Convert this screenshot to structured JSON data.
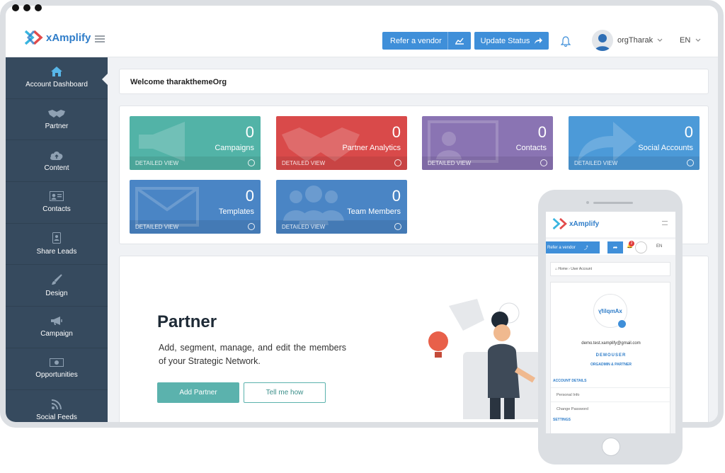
{
  "header": {
    "logo_text": "xAmplify",
    "refer_label": "Refer a vendor",
    "update_label": "Update Status",
    "username": "orgTharak",
    "language": "EN"
  },
  "sidebar": {
    "items": [
      {
        "label": "Account Dashboard",
        "icon": "home-icon"
      },
      {
        "label": "Partner",
        "icon": "handshake-icon"
      },
      {
        "label": "Content",
        "icon": "cloud-upload-icon"
      },
      {
        "label": "Contacts",
        "icon": "contact-card-icon"
      },
      {
        "label": "Share Leads",
        "icon": "share-leads-icon"
      },
      {
        "label": "Design",
        "icon": "brush-icon"
      },
      {
        "label": "Campaign",
        "icon": "megaphone-icon"
      },
      {
        "label": "Opportunities",
        "icon": "money-icon"
      },
      {
        "label": "Social Feeds",
        "icon": "rss-icon"
      }
    ]
  },
  "welcome": "Welcome tharakthemeOrg",
  "stats": [
    {
      "value": "0",
      "title": "Campaigns",
      "footer": "DETAILED VIEW",
      "color": "#52b3a7"
    },
    {
      "value": "0",
      "title": "Partner Analytics",
      "footer": "DETAILED VIEW",
      "color": "#d94a4a"
    },
    {
      "value": "0",
      "title": "Contacts",
      "footer": "DETAILED VIEW",
      "color": "#8a74b3"
    },
    {
      "value": "0",
      "title": "Social Accounts",
      "footer": "DETAILED VIEW",
      "color": "#4c9ad8"
    },
    {
      "value": "0",
      "title": "Templates",
      "footer": "DETAILED VIEW",
      "color": "#4a85c5"
    },
    {
      "value": "0",
      "title": "Team Members",
      "footer": "DETAILED VIEW",
      "color": "#4a85c5"
    }
  ],
  "promo": {
    "title": "Partner",
    "description": "Add, segment, manage, and edit the members of your Strategic Network.",
    "primary_button": "Add Partner",
    "secondary_button": "Tell me how"
  },
  "mobile": {
    "logo_text": "xAmplify",
    "refer_label": "Refer a vendor",
    "notification_count": "2",
    "language": "EN",
    "breadcrumb_home": "Home",
    "breadcrumb_current": "User Account",
    "avatar_text": "xAmplify",
    "email": "demo.test.xamplify@gmail.com",
    "username": "DEMOUSER",
    "role": "ORGADMIN & PARTNER",
    "section_account": "ACCOUNT DETAILS",
    "row_personal": "Personal Info",
    "row_password": "Change Password",
    "section_settings": "SETTINGS"
  }
}
